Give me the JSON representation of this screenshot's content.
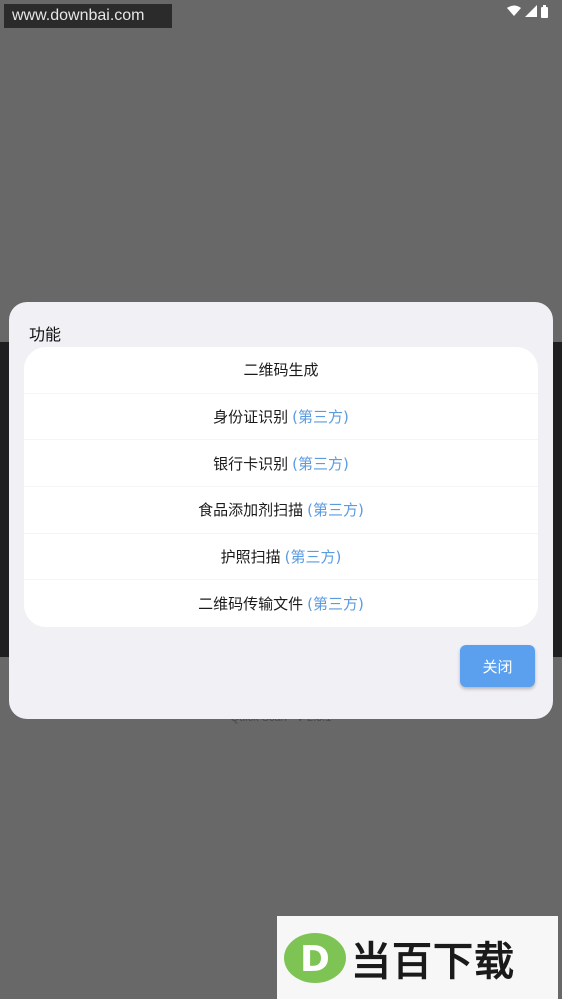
{
  "watermark": {
    "text": "www.downbai.com"
  },
  "status_bar": {
    "icons": [
      "wifi-icon",
      "signal-icon",
      "battery-icon"
    ]
  },
  "background": {
    "version": "Quick Scan - V 2.3.1"
  },
  "dialog": {
    "title": "功能",
    "items": [
      {
        "label": "二维码生成",
        "tag": ""
      },
      {
        "label": "身份证识别",
        "tag": "(第三方)"
      },
      {
        "label": "银行卡识别",
        "tag": "(第三方)"
      },
      {
        "label": "食品添加剂扫描",
        "tag": "(第三方)"
      },
      {
        "label": "护照扫描",
        "tag": "(第三方)"
      },
      {
        "label": "二维码传输文件",
        "tag": "(第三方)"
      }
    ],
    "close_label": "关闭"
  },
  "logo": {
    "letter": "D",
    "text": "当百下载"
  },
  "colors": {
    "accent": "#5ba0ef",
    "tag": "#5b9be0",
    "overlay": "#686868",
    "logo_green": "#7dc455"
  }
}
